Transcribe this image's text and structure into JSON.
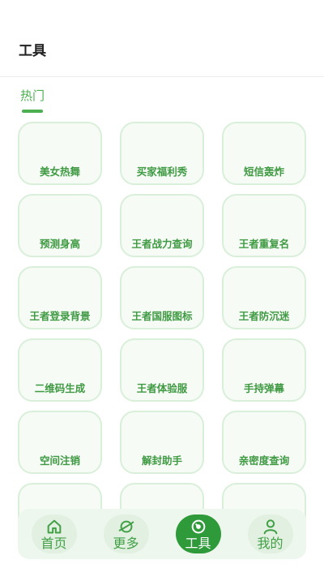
{
  "header": {
    "title": "工具"
  },
  "section": {
    "tab_label": "热门"
  },
  "tools": [
    "美女热舞",
    "买家福利秀",
    "短信轰炸",
    "预测身高",
    "王者战力查询",
    "王者重复名",
    "王者登录背景",
    "王者国服图标",
    "王者防沉迷",
    "二维码生成",
    "王者体验服",
    "手持弹幕",
    "空间注销",
    "解封助手",
    "亲密度查询",
    "",
    "",
    ""
  ],
  "tabbar": {
    "items": [
      {
        "label": "首页",
        "icon": "home-icon",
        "active": false
      },
      {
        "label": "更多",
        "icon": "planet-icon",
        "active": false
      },
      {
        "label": "工具",
        "icon": "compass-icon",
        "active": true
      },
      {
        "label": "我的",
        "icon": "user-icon",
        "active": false
      }
    ]
  },
  "colors": {
    "accent": "#4caf50",
    "active_pill": "#2e9a3a",
    "tile_border": "#d9efd9"
  }
}
